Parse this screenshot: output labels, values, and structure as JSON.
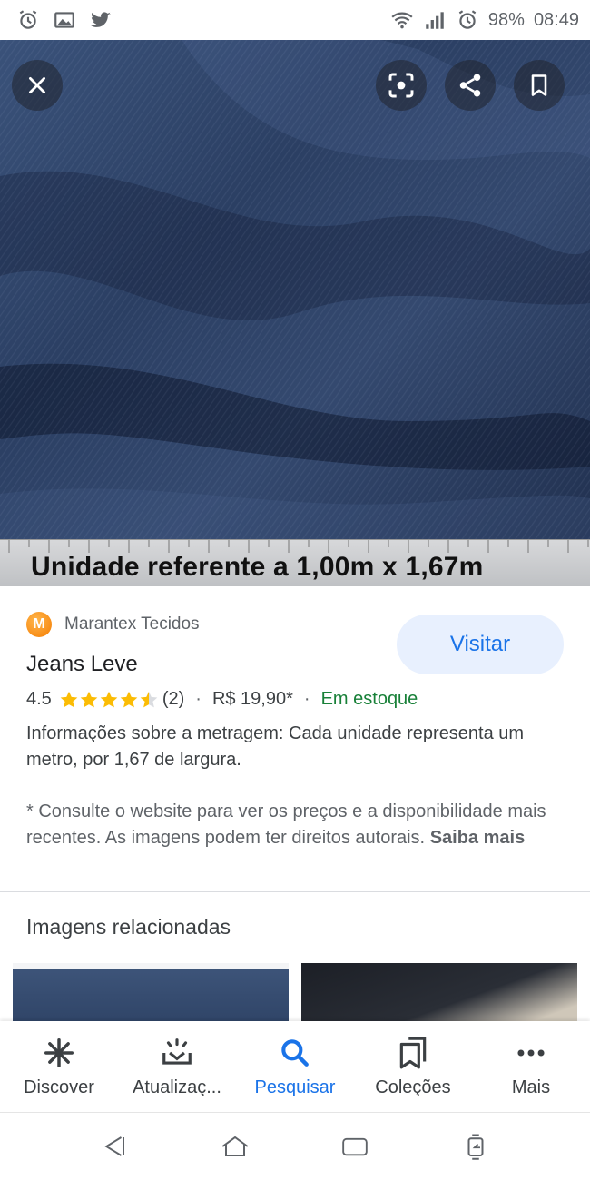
{
  "status_bar": {
    "battery": "98%",
    "time": "08:49",
    "icons_left": [
      "alarm-icon",
      "gallery-icon",
      "twitter-icon"
    ],
    "icons_right": [
      "wifi-icon",
      "signal-icon",
      "alarm-icon",
      "battery-icon"
    ]
  },
  "hero": {
    "caption": "Unidade referente a 1,00m x 1,67m",
    "buttons": [
      "close-icon",
      "lens-icon",
      "share-icon",
      "bookmark-icon"
    ]
  },
  "product": {
    "merchant": "Marantex Tecidos",
    "merchant_logo_letter": "M",
    "title": "Jeans Leve",
    "rating": "4.5",
    "rating_value": 4.5,
    "rating_max": 5,
    "reviews": "(2)",
    "price": "R$ 19,90*",
    "stock": "Em estoque",
    "description": "Informações sobre a metragem: Cada unidade representa um metro, por 1,67 de largura.",
    "disclaimer": "* Consulte o website para ver os preços e a disponibilidade mais recentes. As imagens podem ter direitos autorais.",
    "learn_more": "Saiba mais",
    "visit_label": "Visitar"
  },
  "related": {
    "title": "Imagens relacionadas"
  },
  "bottom_nav": {
    "items": [
      {
        "label": "Discover",
        "icon": "asterisk-icon"
      },
      {
        "label": "Atualizaç...",
        "icon": "updates-icon"
      },
      {
        "label": "Pesquisar",
        "icon": "search-icon",
        "active": true
      },
      {
        "label": "Coleções",
        "icon": "collections-icon"
      },
      {
        "label": "Mais",
        "icon": "more-icon"
      }
    ]
  },
  "colors": {
    "accent": "#1a73e8",
    "stock": "#188038",
    "star": "#fbbc04"
  }
}
